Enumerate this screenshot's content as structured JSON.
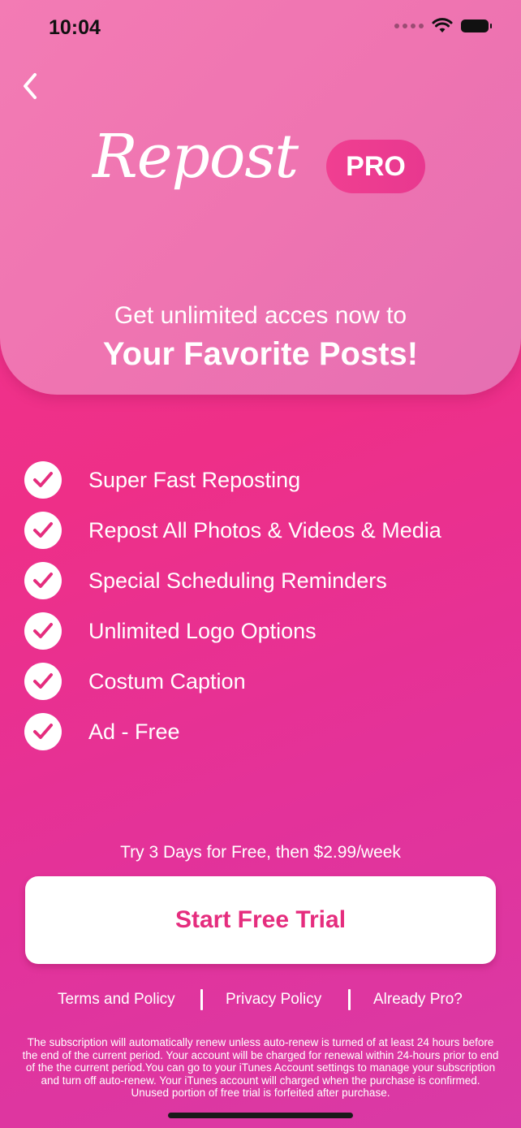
{
  "status_bar": {
    "time": "10:04"
  },
  "header": {
    "logo_text": "Repost",
    "badge": "PRO",
    "subtitle": "Get unlimited acces now to",
    "headline": "Your Favorite Posts!"
  },
  "features": [
    {
      "label": "Super Fast Reposting"
    },
    {
      "label": "Repost All Photos & Videos & Media"
    },
    {
      "label": "Special Scheduling Reminders"
    },
    {
      "label": "Unlimited Logo Options"
    },
    {
      "label": "Costum Caption"
    },
    {
      "label": "Ad - Free"
    }
  ],
  "offer": {
    "trial_text": "Try 3 Days for Free, then $2.99/week",
    "cta_label": "Start Free Trial"
  },
  "links": {
    "terms": "Terms and Policy",
    "privacy": "Privacy Policy",
    "already_pro": "Already Pro?"
  },
  "fineprint": "The subscription will automatically renew unless auto-renew is turned of at least 24 hours before the end of the current period. Your account will be charged for renewal within 24-hours prior to end of the the current period.You can go to your iTunes Account settings to manage your subscription and turn off auto-renew. Your iTunes account will charged when the purchase is confirmed. Unused portion of free trial is forfeited after purchase.",
  "icons": {
    "back": "chevron-left-icon",
    "check": "checkmark-icon",
    "wifi": "wifi-icon",
    "battery": "battery-icon",
    "signal": "signal-icon"
  },
  "colors": {
    "accent": "#e52d7e",
    "background": "#f2358e",
    "header": "#ef74b1"
  }
}
